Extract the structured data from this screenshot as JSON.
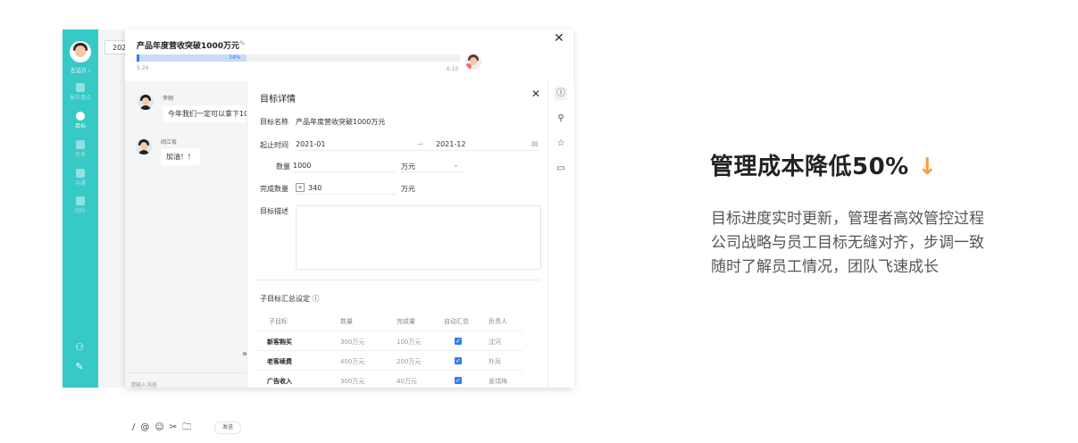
{
  "sidebar": {
    "user_name": "左边方",
    "items": [
      {
        "label": "报告盘点",
        "active": false
      },
      {
        "label": "目标",
        "active": true
      },
      {
        "label": "任务",
        "active": false
      },
      {
        "label": "沟通",
        "active": false
      },
      {
        "label": "团队",
        "active": false
      }
    ]
  },
  "background_chip": "202",
  "goal": {
    "title": "产品年度营收突破1000万元",
    "progress": 0.34,
    "progress_label": "34%",
    "start_date": "5.24",
    "end_date": "6.10"
  },
  "chat": {
    "messages": [
      {
        "name": "李翔",
        "text": "今年我们一定可以拿下1000"
      },
      {
        "name": "阎江俊",
        "text": "加油！！"
      }
    ],
    "input_placeholder": "请输入消息",
    "send_label": "发送",
    "tools": [
      "/",
      "@",
      "☺",
      "✂",
      "🗀"
    ]
  },
  "detail": {
    "title": "目标详情",
    "fields": {
      "name_label": "目标名称",
      "name_value": "产品年度营收突破1000万元",
      "period_label": "起止时间",
      "period_start": "2021-01",
      "period_sep": "→",
      "period_end": "2021-12",
      "qty_label": "数量",
      "qty_value": "1000",
      "qty_unit": "万元",
      "done_label": "完成数量",
      "done_value": "340",
      "done_unit": "万元",
      "desc_label": "目标描述"
    },
    "sub_title": "子目标汇总设定 ⓘ",
    "table": {
      "headers": [
        "子目标",
        "数量",
        "完成量",
        "自动汇总",
        "负责人"
      ],
      "rows": [
        {
          "name": "新客购买",
          "qty": "300万元",
          "done": "100万元",
          "auto": true,
          "owner": "沈河"
        },
        {
          "name": "老客续费",
          "qty": "400万元",
          "done": "200万元",
          "auto": true,
          "owner": "朴凤"
        },
        {
          "name": "广告收入",
          "qty": "300万元",
          "done": "40万元",
          "auto": true,
          "owner": "姜瑞梅"
        }
      ]
    }
  },
  "marketing": {
    "headline": "管理成本降低50%",
    "arrow": "↓",
    "lines": [
      "目标进度实时更新，管理者高效管控过程",
      "公司战略与员工目标无缝对齐，步调一致",
      "随时了解员工情况，团队飞速成长"
    ]
  },
  "colors": {
    "sidebar": "#36c9c6",
    "accent_blue": "#3b7ddd",
    "arrow_orange": "#ff9b3a"
  }
}
